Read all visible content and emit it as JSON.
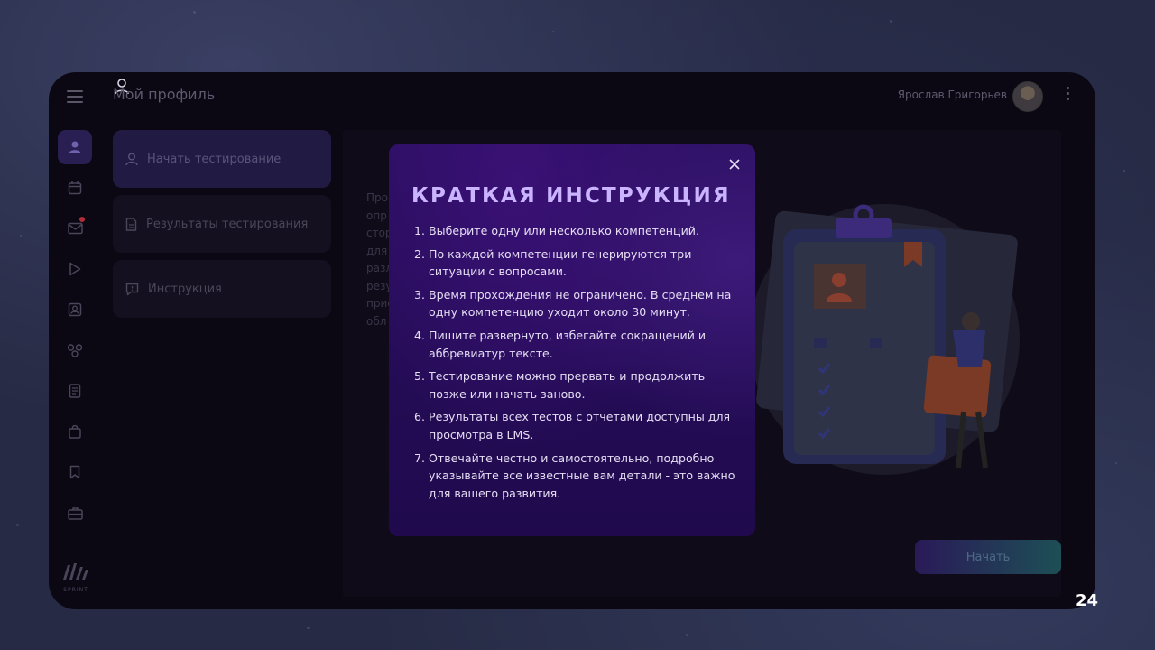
{
  "header": {
    "page_title": "Мой профиль",
    "user_name": "Ярослав Григорьев"
  },
  "rail": {
    "items": [
      {
        "icon": "user-icon",
        "active": true
      },
      {
        "icon": "calendar-icon"
      },
      {
        "icon": "mail-icon",
        "has_notification": true
      },
      {
        "icon": "play-icon"
      },
      {
        "icon": "contact-card-icon"
      },
      {
        "icon": "network-icon"
      },
      {
        "icon": "document-icon"
      },
      {
        "icon": "shopping-bag-icon"
      },
      {
        "icon": "bookmark-icon"
      },
      {
        "icon": "briefcase-icon"
      }
    ],
    "logo_text": "SPRINT"
  },
  "submenu": {
    "items": [
      {
        "label": "Начать тестирование",
        "icon": "user-icon",
        "active": true
      },
      {
        "label": "Результаты тестирования",
        "icon": "document-icon"
      },
      {
        "label": "Инструкция",
        "icon": "chat-icon"
      }
    ]
  },
  "content": {
    "background_text": [
      "Про",
      "опр",
      "стор",
      "для",
      "разл",
      "резу",
      "прис",
      "обл"
    ],
    "start_button": "Начать"
  },
  "modal": {
    "title": "КРАТКАЯ ИНСТРУКЦИЯ",
    "steps": [
      {
        "num": "1.",
        "text": "Выберите одну или несколько компетенций."
      },
      {
        "num": "2.",
        "text": "По каждой компетенции генерируются три ситуации с вопросами."
      },
      {
        "num": "3.",
        "text": "Время прохождения не ограничено. В среднем на одну компетенцию уходит около 30 минут."
      },
      {
        "num": "4.",
        "text": "Пишите развернуто, избегайте сокращений и аббревиатур тексте."
      },
      {
        "num": "5.",
        "text": "Тестирование можно прервать и продолжить позже или начать заново."
      },
      {
        "num": "6.",
        "text": "Результаты всех тестов с отчетами доступны для просмотра в LMS."
      },
      {
        "num": "7.",
        "text": "Отвечайте честно и самостоятельно, подробно указывайте все известные вам детали - это важно для вашего развития."
      }
    ]
  },
  "slide": {
    "page_number": "24"
  },
  "colors": {
    "modal_bg": "#2b0f62",
    "modal_title": "#cbb4ff",
    "app_bg": "#0b0814",
    "accent": "#2a1f53"
  }
}
